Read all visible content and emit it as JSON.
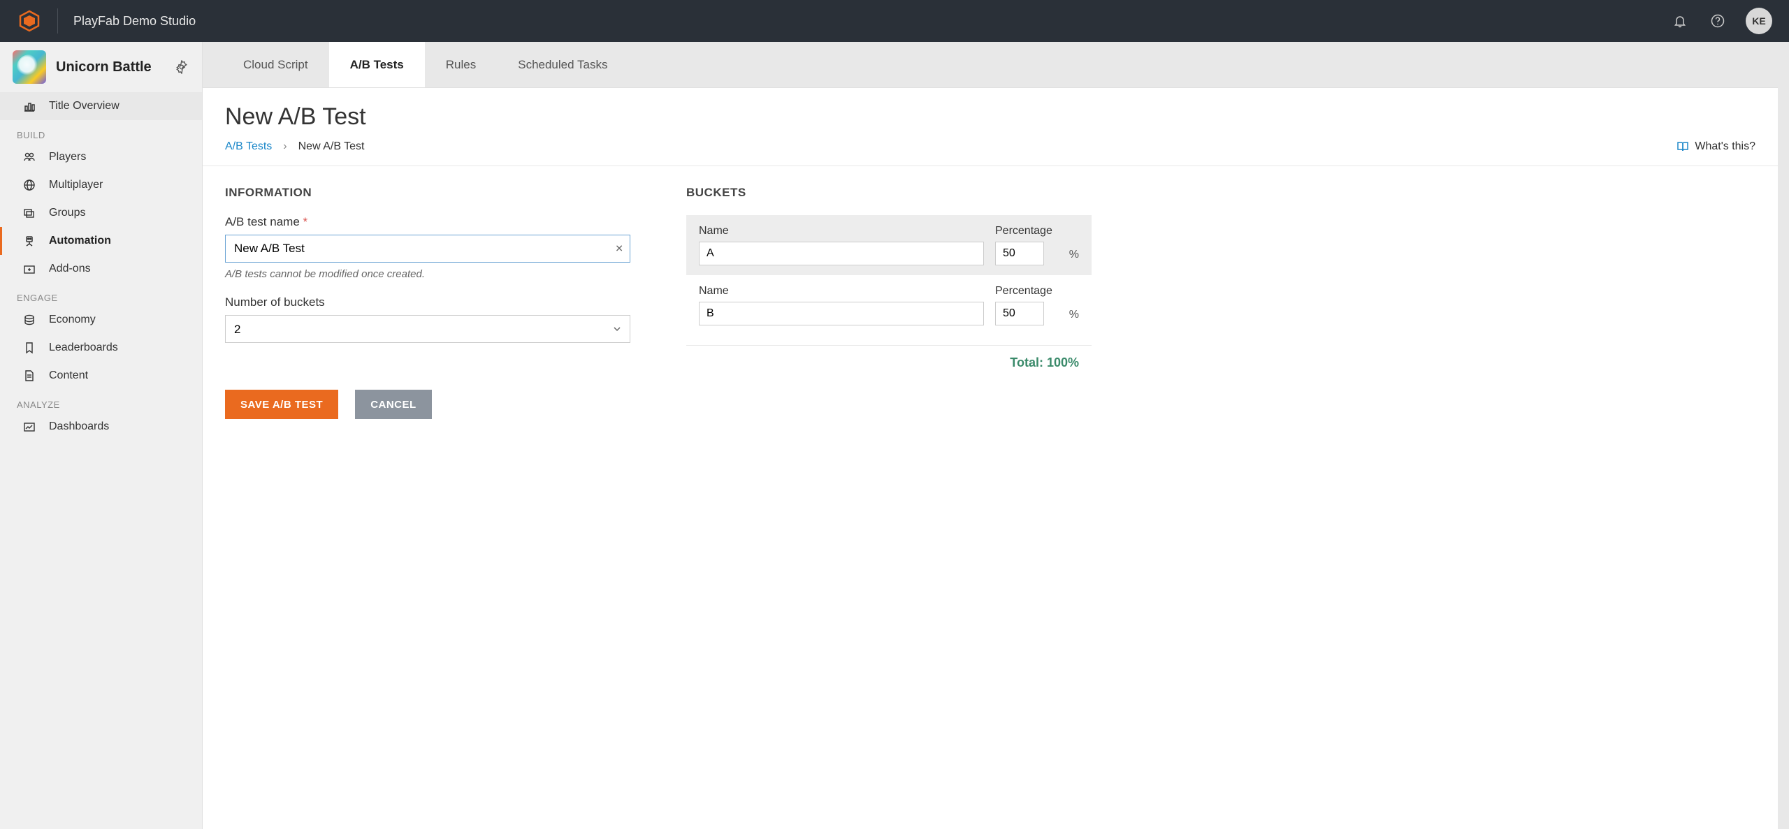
{
  "header": {
    "studio_name": "PlayFab Demo Studio",
    "avatar_initials": "KE"
  },
  "sidebar": {
    "title_name": "Unicorn Battle",
    "title_overview": "Title Overview",
    "sections": {
      "build": "BUILD",
      "engage": "ENGAGE",
      "analyze": "ANALYZE"
    },
    "items": {
      "players": "Players",
      "multiplayer": "Multiplayer",
      "groups": "Groups",
      "automation": "Automation",
      "addons": "Add-ons",
      "economy": "Economy",
      "leaderboards": "Leaderboards",
      "content": "Content",
      "dashboards": "Dashboards"
    }
  },
  "tabs": {
    "cloud_script": "Cloud Script",
    "ab_tests": "A/B Tests",
    "rules": "Rules",
    "scheduled_tasks": "Scheduled Tasks"
  },
  "page": {
    "title": "New A/B Test",
    "breadcrumb_link": "A/B Tests",
    "breadcrumb_current": "New A/B Test",
    "whats_this": "What's this?"
  },
  "form": {
    "section_information": "INFORMATION",
    "test_name_label": "A/B test name",
    "test_name_value": "New A/B Test",
    "hint": "A/B tests cannot be modified once created.",
    "num_buckets_label": "Number of buckets",
    "num_buckets_value": "2",
    "section_buckets": "BUCKETS",
    "col_name": "Name",
    "col_percentage": "Percentage",
    "buckets": [
      {
        "name": "A",
        "pct": "50"
      },
      {
        "name": "B",
        "pct": "50"
      }
    ],
    "total_label": "Total: 100%"
  },
  "buttons": {
    "save": "SAVE A/B TEST",
    "cancel": "CANCEL"
  }
}
